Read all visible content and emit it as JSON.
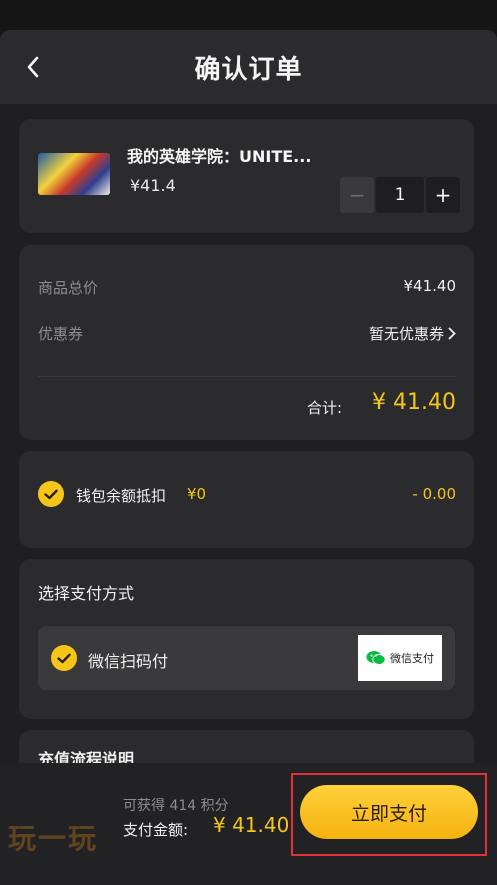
{
  "header": {
    "title": "确认订单"
  },
  "product": {
    "name": "我的英雄学院：UNITE...",
    "price": "¥41.4",
    "quantity": "1",
    "minus": "−",
    "plus": "+"
  },
  "summary": {
    "total_label": "商品总价",
    "total_value": "¥41.40",
    "coupon_label": "优惠券",
    "coupon_value": "暂无优惠券",
    "sum_label": "合计:",
    "sum_value": "¥ 41.40"
  },
  "wallet": {
    "label": "钱包余额抵扣",
    "amount": "¥0",
    "deduct": "- 0.00"
  },
  "payment": {
    "title": "选择支付方式",
    "option_label": "微信扫码付",
    "badge_text": "微信支付"
  },
  "recharge": {
    "title": "充值流程说明"
  },
  "footer": {
    "points": "可获得 414 积分",
    "pay_label": "支付金额:",
    "pay_amount": "¥ 41.40",
    "pay_button": "立即支付"
  },
  "watermark": "玩一玩",
  "colors": {
    "accent": "#f5c518",
    "highlight_frame": "#e0303a",
    "card": "#2b2b2d"
  }
}
